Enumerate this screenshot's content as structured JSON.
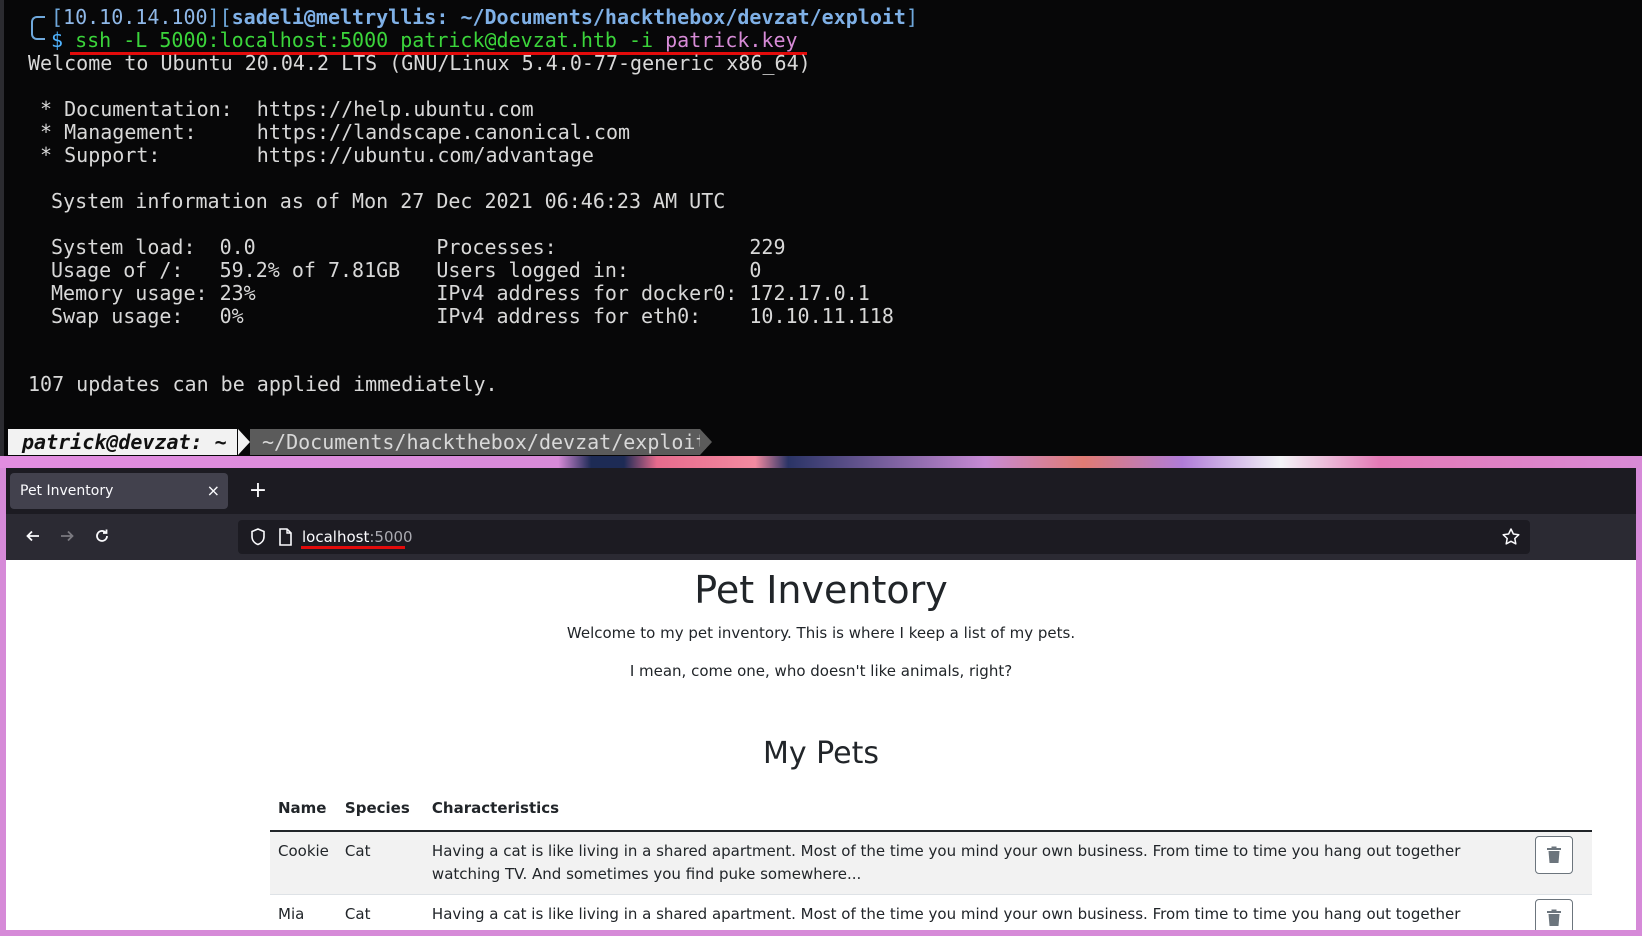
{
  "terminal": {
    "prompt": {
      "bracket_open": "[",
      "ip": "10.10.14.100",
      "bracket_mid": "][",
      "user_host": "sadeli@meltryllis:",
      "path": "~/Documents/hackthebox/devzat/exploit",
      "bracket_close": "]",
      "dollar": "$",
      "command": "ssh -L 5000:localhost:5000 patrick@devzat.htb -i",
      "keyfile": "patrick.key"
    },
    "welcome": "Welcome to Ubuntu 20.04.2 LTS (GNU/Linux 5.4.0-77-generic x86_64)",
    "docs": " * Documentation:  https://help.ubuntu.com",
    "management": " * Management:     https://landscape.canonical.com",
    "support": " * Support:        https://ubuntu.com/advantage",
    "sysinfo": "System information as of Mon 27 Dec 2021 06:46:23 AM UTC",
    "stats": [
      "System load:  0.0               Processes:                229",
      "Usage of /:   59.2% of 7.81GB   Users logged in:          0",
      "Memory usage: 23%               IPv4 address for docker0: 172.17.0.1",
      "Swap usage:   0%                IPv4 address for eth0:    10.10.11.118"
    ],
    "updates": "107 updates can be applied immediately.",
    "status_user": "patrick@devzat: ~",
    "status_path": "~/Documents/hackthebox/devzat/exploit"
  },
  "browser": {
    "tab_title": "Pet Inventory",
    "tab_close": "×",
    "new_tab": "+",
    "url_host": "localhost",
    "url_port": ":5000",
    "icons": [
      "back-arrow-icon",
      "forward-arrow-icon",
      "reload-icon",
      "shield-icon",
      "page-icon",
      "star-icon",
      "trash-icon"
    ]
  },
  "page": {
    "title": "Pet Inventory",
    "intro1": "Welcome to my pet inventory. This is where I keep a list of my pets.",
    "intro2": "I mean, come one, who doesn't like animals, right?",
    "pets_heading": "My Pets",
    "columns": [
      "Name",
      "Species",
      "Characteristics"
    ],
    "pets": [
      {
        "name": "Cookie",
        "species": "Cat",
        "characteristics": "Having a cat is like living in a shared apartment. Most of the time you mind your own business. From time to time you hang out together watching TV. And sometimes you find puke somewhere..."
      },
      {
        "name": "Mia",
        "species": "Cat",
        "characteristics": "Having a cat is like living in a shared apartment. Most of the time you mind your own business. From time to time you hang out together watching TV. And sometimes you find puke somewhere..."
      }
    ]
  }
}
